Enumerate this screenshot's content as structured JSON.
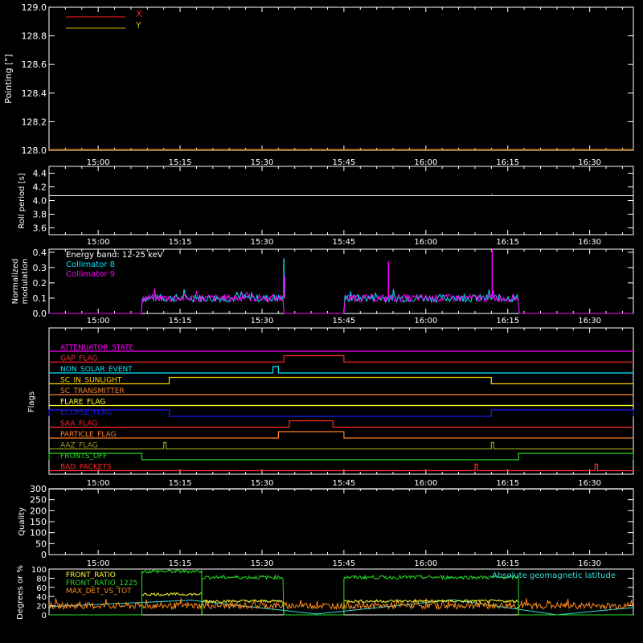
{
  "colors": {
    "background": "#000000",
    "axis": "#ffffff",
    "x_series": "#ff2020",
    "y_series": "#c8b400",
    "collimator8": "#00e5ff",
    "collimator9": "#ff00ff",
    "front_ratio": "#ffff33",
    "front_ratio_1225": "#22dd22",
    "max_det": "#ff8c1a",
    "geomag": "#33dddd"
  },
  "time_ticks": [
    "15:00",
    "15:15",
    "15:30",
    "15:45",
    "16:00",
    "16:15",
    "16:30"
  ],
  "chart_data": [
    {
      "id": "pointing",
      "type": "line",
      "ylabel": "Pointing [\"]",
      "ylim": [
        128.0,
        129.0
      ],
      "yticks": [
        "129.0",
        "128.8",
        "128.6",
        "128.4",
        "128.2",
        "128.0"
      ],
      "series": [
        {
          "name": "X",
          "x": [
            "14:51",
            "16:38"
          ],
          "values": [
            128.0,
            128.0
          ]
        },
        {
          "name": "Y",
          "x": [
            "14:51",
            "16:38"
          ],
          "values": [
            128.0,
            128.0
          ]
        }
      ]
    },
    {
      "id": "roll",
      "type": "line",
      "ylabel": "Roll period [s]",
      "ylim": [
        3.5,
        4.5
      ],
      "yticks": [
        "4.4",
        "4.2",
        "4.0",
        "3.8",
        "3.6"
      ],
      "series": [
        {
          "name": "",
          "x": [
            "14:51",
            "16:38"
          ],
          "values": [
            4.07,
            4.07
          ]
        }
      ]
    },
    {
      "id": "modulation",
      "type": "line",
      "ylabel_lines": [
        "Normalized",
        "modulation"
      ],
      "ylim": [
        0.0,
        0.42
      ],
      "yticks": [
        "0.4",
        "0.3",
        "0.2",
        "0.1",
        "0.0"
      ],
      "annotation": "Energy band: 12-25 keV",
      "series": [
        {
          "name": "Collimator 8",
          "active": [
            [
              "15:08",
              "15:34"
            ],
            [
              "15:45",
              "16:17"
            ]
          ],
          "level": 0.1,
          "spikes": [
            [
              "15:34",
              0.36
            ]
          ]
        },
        {
          "name": "Collimator 9",
          "active": [
            [
              "15:08",
              "15:34"
            ],
            [
              "15:45",
              "16:17"
            ]
          ],
          "level": 0.1,
          "spikes": [
            [
              "15:34",
              0.25
            ],
            [
              "15:53",
              0.34
            ],
            [
              "16:12",
              0.42
            ]
          ]
        }
      ]
    },
    {
      "id": "flags",
      "type": "line",
      "ylabel": "Flags",
      "flags": [
        {
          "name": "ATTENUATOR_STATE",
          "color": "#ff00ff",
          "highs": []
        },
        {
          "name": "GAP_FLAG",
          "color": "#ff2a2a",
          "highs": [
            [
              "15:34",
              "15:45"
            ]
          ]
        },
        {
          "name": "NON_SOLAR_EVENT",
          "color": "#00e5ff",
          "highs": [
            [
              "15:32",
              "15:33"
            ]
          ]
        },
        {
          "name": "SC_IN_SUNLIGHT",
          "color": "#ffd000",
          "highs": [
            [
              "15:13",
              "16:12"
            ]
          ]
        },
        {
          "name": "SC_TRANSMITTER",
          "color": "#ff7f2a",
          "highs": []
        },
        {
          "name": "FLARE_FLAG",
          "color": "#ffff33",
          "highs": []
        },
        {
          "name": "ECLIPSE_FLAG",
          "color": "#1a1aff",
          "highs": [
            [
              "14:51",
              "15:13"
            ],
            [
              "16:12",
              "16:38"
            ]
          ]
        },
        {
          "name": "SAA_FLAG",
          "color": "#ff2a2a",
          "highs": [
            [
              "15:35",
              "15:43"
            ]
          ]
        },
        {
          "name": "PARTICLE_FLAG",
          "color": "#ff7f2a",
          "highs": [
            [
              "15:33",
              "15:45"
            ]
          ]
        },
        {
          "name": "AAZ_FLAG",
          "color": "#9a9a22",
          "highs": [
            [
              "15:12",
              "15:12"
            ],
            [
              "16:12",
              "16:12"
            ]
          ]
        },
        {
          "name": "FRONTS_OFF",
          "color": "#22dd22",
          "highs": [
            [
              "14:51",
              "15:08"
            ],
            [
              "16:17",
              "16:38"
            ]
          ]
        },
        {
          "name": "BAD_PACKETS",
          "color": "#ff2a2a",
          "highs": [
            [
              "16:09",
              "16:09"
            ],
            [
              "16:31",
              "16:31"
            ]
          ]
        }
      ]
    },
    {
      "id": "quality",
      "type": "line",
      "ylabel": "Quality",
      "ylim": [
        0,
        300
      ],
      "yticks": [
        "300",
        "250",
        "200",
        "150",
        "100",
        "50",
        "0"
      ],
      "series": [
        {
          "name": "",
          "x": [
            "14:51",
            "16:38"
          ],
          "values": [
            300,
            300
          ]
        }
      ]
    },
    {
      "id": "ratios",
      "type": "line",
      "ylabel": "Degrees or %",
      "ylim": [
        0,
        100
      ],
      "yticks": [
        "100",
        "80",
        "60",
        "40",
        "20",
        "0"
      ],
      "annotation": "Absolute geomagnetic latitude",
      "series": [
        {
          "name": "FRONT_RATIO",
          "segments": [
            [
              "15:08",
              "15:19",
              45
            ],
            [
              "15:19",
              "15:34",
              30
            ],
            [
              "15:45",
              "16:17",
              30
            ]
          ]
        },
        {
          "name": "FRONT_RATIO_1225",
          "segments": [
            [
              "15:08",
              "15:19",
              95
            ],
            [
              "15:19",
              "15:34",
              82
            ],
            [
              "15:45",
              "16:17",
              82
            ]
          ]
        },
        {
          "name": "MAX_DET_VS_TOT",
          "level": 20
        },
        {
          "name": "Absolute geomagnetic latitude",
          "x": [
            "14:51",
            "15:17",
            "15:40",
            "16:05",
            "16:24",
            "16:38"
          ],
          "values": [
            18,
            32,
            2,
            33,
            0,
            16
          ]
        }
      ]
    }
  ]
}
